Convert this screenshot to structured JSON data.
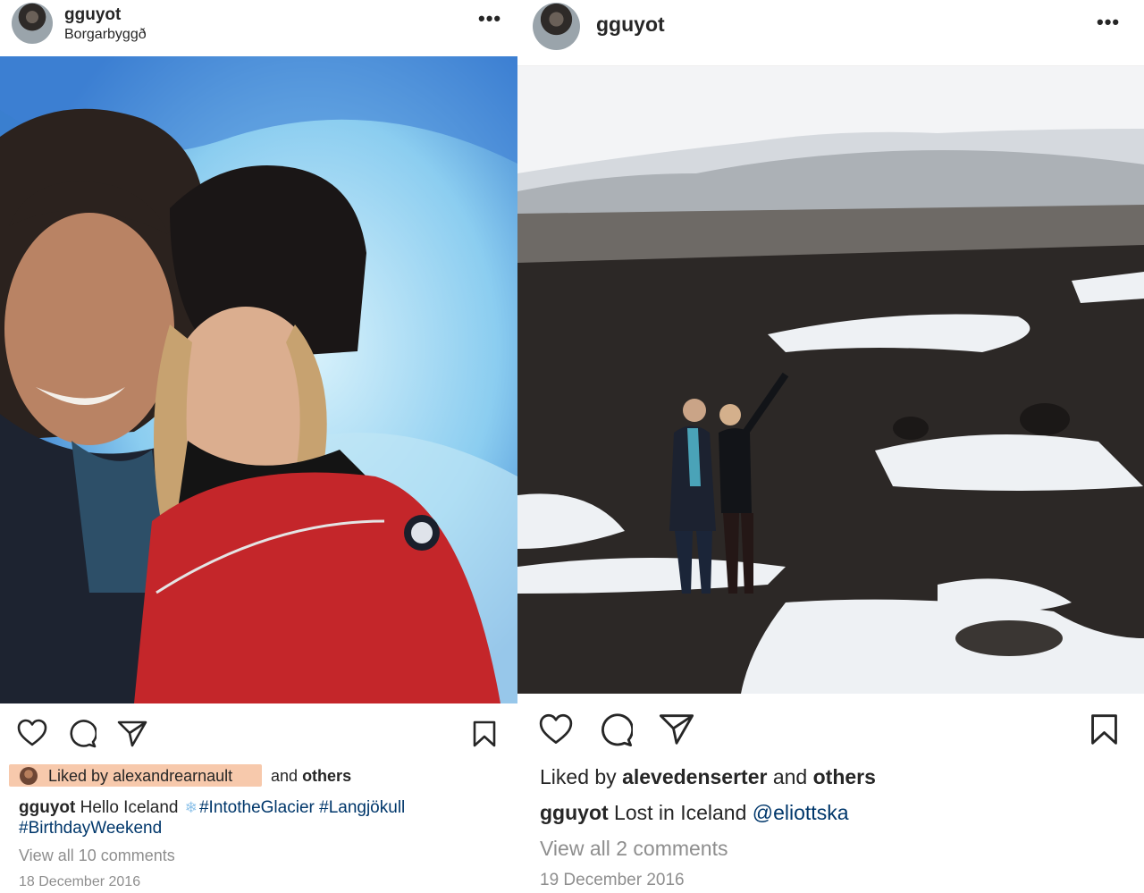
{
  "posts": [
    {
      "username": "gguyot",
      "location": "Borgarbyggð",
      "more": "•••",
      "liked_by_prefix": "Liked by",
      "liked_by_user": "alexandrearnault",
      "liked_by_and": "and",
      "liked_by_others": "others",
      "caption_user": "gguyot",
      "caption_text": "Hello Iceland",
      "caption_emoji": "❄",
      "hashtags": [
        "#IntotheGlacier",
        "#Langjökull",
        "#BirthdayWeekend"
      ],
      "comments": "View all 10 comments",
      "date": "18 December 2016"
    },
    {
      "username": "gguyot",
      "more": "•••",
      "liked_by_prefix": "Liked by",
      "liked_by_user": "alevedenserter",
      "liked_by_and": "and",
      "liked_by_others": "others",
      "caption_user": "gguyot",
      "caption_text": "Lost in Iceland",
      "mention": "@eliottska",
      "comments": "View all 2 comments",
      "date": "19 December 2016"
    }
  ],
  "icons": [
    "heart-icon",
    "comment-icon",
    "share-icon",
    "bookmark-icon"
  ],
  "colors": {
    "highlight": "#f7c9ac",
    "link": "#00376b",
    "muted": "#8e8e8e"
  }
}
